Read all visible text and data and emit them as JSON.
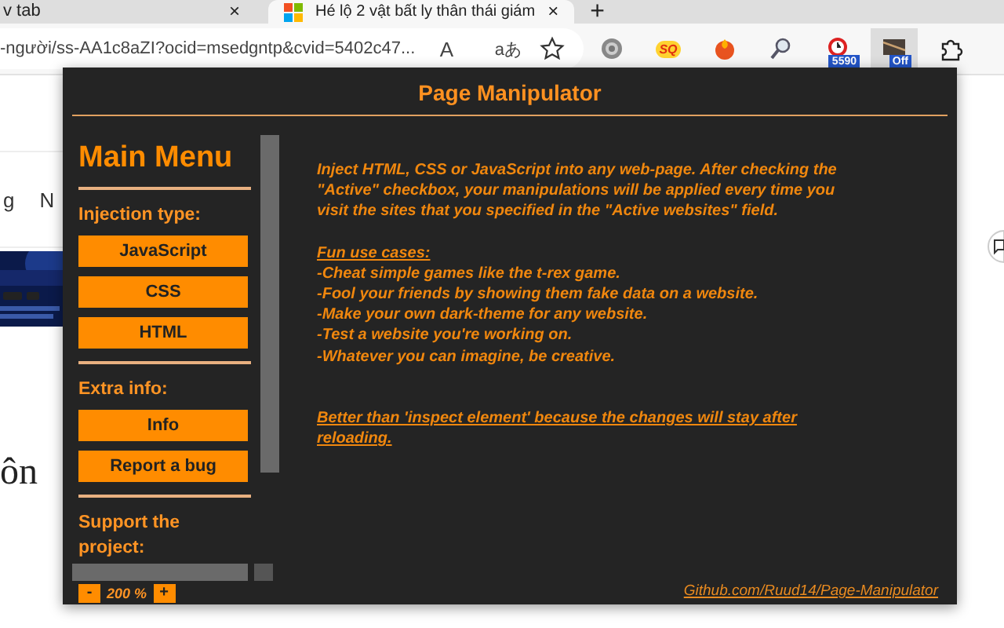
{
  "browser": {
    "tabs": [
      {
        "title": "v tab",
        "close": "×",
        "selected": false
      },
      {
        "title": "Hé lộ 2 vật bất ly thân thái giám",
        "close": "×",
        "selected": true
      }
    ],
    "new_tab": "+",
    "address": "-người/ss-AA1c8aZI?ocid=msedgntp&cvid=5402c47...",
    "read_aloud": "A",
    "translate": "aあ",
    "extensions": [
      {
        "kind": "gear"
      },
      {
        "kind": "sq",
        "label": "SQ"
      },
      {
        "kind": "flame"
      },
      {
        "kind": "magnifier"
      },
      {
        "kind": "clock",
        "badge": "5590"
      },
      {
        "kind": "screen",
        "badge": "Off",
        "selected": true
      },
      {
        "kind": "puzzle"
      }
    ]
  },
  "page": {
    "left_texts": [
      "g",
      "N"
    ],
    "heading_fragment": "ôn"
  },
  "popup": {
    "title": "Page Manipulator",
    "menu": {
      "heading": "Main Menu",
      "sections": [
        {
          "label": "Injection type:",
          "buttons": [
            "JavaScript",
            "CSS",
            "HTML"
          ]
        },
        {
          "label": "Extra info:",
          "buttons": [
            "Info",
            "Report a bug"
          ]
        },
        {
          "label": "Support the project:"
        }
      ]
    },
    "intro": "Inject HTML, CSS or JavaScript into any web-page. After checking the \"Active\" checkbox, your manipulations will be applied every time you visit the sites that you specified in the \"Active websites\" field.",
    "fun_heading": "Fun use cases:",
    "fun_items": [
      "-Cheat simple games like the t-rex game.",
      "-Fool your friends by showing them fake data on a website.",
      "-Make your own dark-theme for any website.",
      "-Test a website you're working on.",
      "-Whatever you can imagine, be creative."
    ],
    "note": "Better than 'inspect element' because the changes will stay after reloading.",
    "link": "Github.com/Ruud14/Page-Manipulator",
    "zoom": {
      "minus": "-",
      "value": "200 %",
      "plus": "+"
    }
  }
}
